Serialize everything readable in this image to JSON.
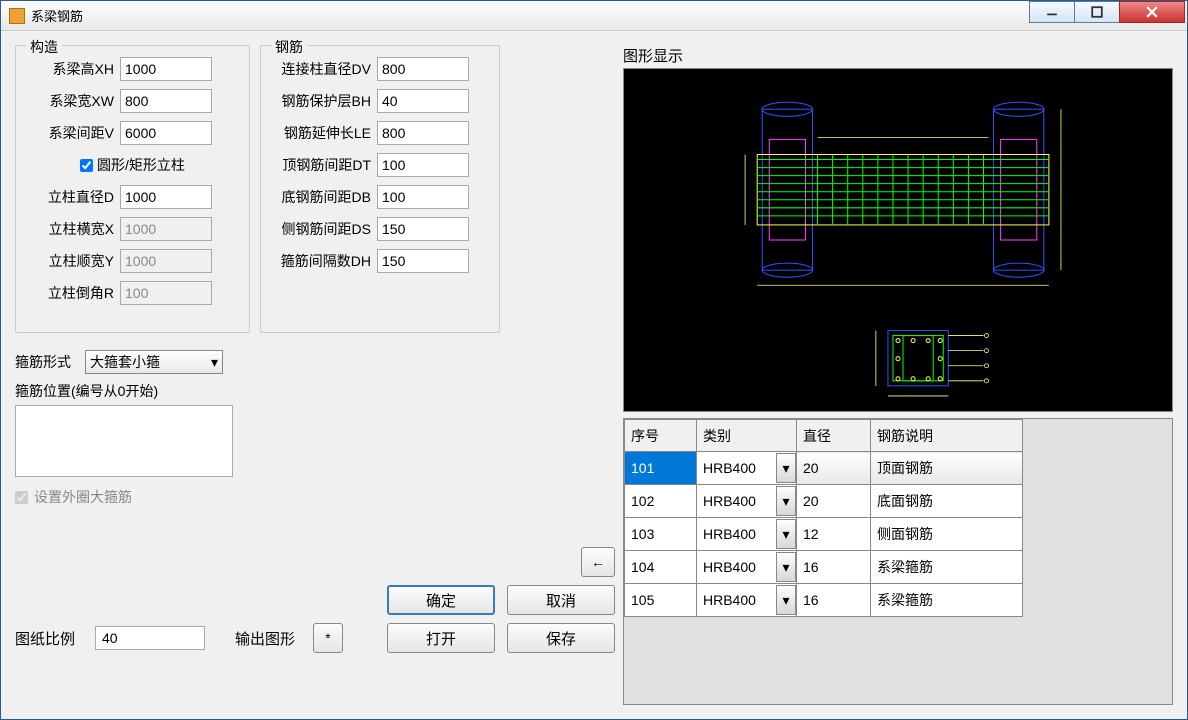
{
  "window": {
    "title": "系梁钢筋"
  },
  "groups": {
    "structure": {
      "legend": "构造",
      "fields": {
        "xh": {
          "label": "系梁高XH",
          "value": "1000"
        },
        "xw": {
          "label": "系梁宽XW",
          "value": "800"
        },
        "v": {
          "label": "系梁间距V",
          "value": "6000"
        },
        "shape": {
          "label": "圆形/矩形立柱",
          "checked": true
        },
        "d": {
          "label": "立柱直径D",
          "value": "1000"
        },
        "x": {
          "label": "立柱横宽X",
          "value": "1000",
          "disabled": true
        },
        "y": {
          "label": "立柱顺宽Y",
          "value": "1000",
          "disabled": true
        },
        "r": {
          "label": "立柱倒角R",
          "value": "100",
          "disabled": true
        }
      }
    },
    "rebar": {
      "legend": "钢筋",
      "fields": {
        "dv": {
          "label": "连接柱直径DV",
          "value": "800"
        },
        "bh": {
          "label": "钢筋保护层BH",
          "value": "40"
        },
        "le": {
          "label": "钢筋延伸长LE",
          "value": "800"
        },
        "dt": {
          "label": "顶钢筋间距DT",
          "value": "100"
        },
        "db": {
          "label": "底钢筋间距DB",
          "value": "100"
        },
        "ds": {
          "label": "侧钢筋间距DS",
          "value": "150"
        },
        "dh": {
          "label": "箍筋间隔数DH",
          "value": "150"
        }
      }
    }
  },
  "stirrup": {
    "type_label": "箍筋形式",
    "type_value": "大箍套小箍",
    "pos_label": "箍筋位置(编号从0开始)",
    "outer_label": "设置外圈大箍筋",
    "outer_checked": true
  },
  "buttons": {
    "arrow": "←",
    "ok": "确定",
    "cancel": "取消",
    "open": "打开",
    "save": "保存",
    "star": "*"
  },
  "scale": {
    "label": "图纸比例",
    "value": "40",
    "output_label": "输出图形"
  },
  "preview": {
    "legend": "图形显示"
  },
  "table": {
    "headers": {
      "seq": "序号",
      "cat": "类别",
      "dia": "直径",
      "desc": "钢筋说明"
    },
    "rows": [
      {
        "seq": "101",
        "cat": "HRB400",
        "dia": "20",
        "desc": "顶面钢筋",
        "selected": true
      },
      {
        "seq": "102",
        "cat": "HRB400",
        "dia": "20",
        "desc": "底面钢筋"
      },
      {
        "seq": "103",
        "cat": "HRB400",
        "dia": "12",
        "desc": "侧面钢筋"
      },
      {
        "seq": "104",
        "cat": "HRB400",
        "dia": "16",
        "desc": "系梁箍筋"
      },
      {
        "seq": "105",
        "cat": "HRB400",
        "dia": "16",
        "desc": "系梁箍筋"
      }
    ]
  }
}
